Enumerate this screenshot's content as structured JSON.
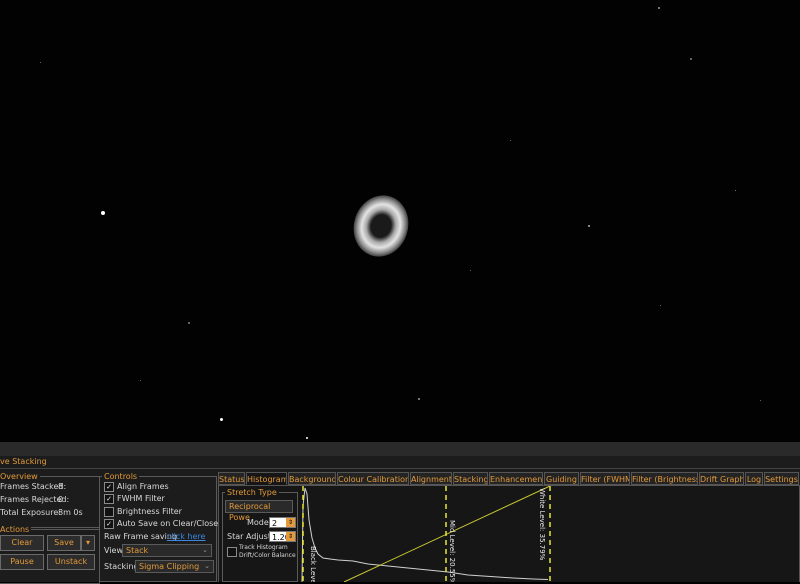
{
  "panel": {
    "title": "ve Stacking"
  },
  "overview": {
    "label": "Overview",
    "frames_stacked_label": "Frames Stacked:",
    "frames_stacked": "8",
    "frames_rejected_label": "Frames Rejected:",
    "frames_rejected": "0",
    "total_exposure_label": "Total Exposure:",
    "total_exposure": "8m 0s"
  },
  "actions": {
    "label": "Actions",
    "clear": "Clear",
    "save": "Save",
    "save_arrow": "▾",
    "pause": "Pause",
    "unstack": "Unstack"
  },
  "controls": {
    "label": "Controls",
    "align_frames": "Align Frames",
    "align_frames_checked": true,
    "fwhm_filter": "FWHM Filter",
    "fwhm_filter_checked": true,
    "brightness_filter": "Brightness Filter",
    "brightness_filter_checked": false,
    "auto_save": "Auto Save on Clear/Close",
    "auto_save_checked": true,
    "raw_frame_label": "Raw Frame saving",
    "raw_frame_link": "click here",
    "view_label": "View",
    "view_value": "Stack",
    "stacking_label": "Stacking",
    "stacking_value": "Sigma Clipping"
  },
  "tabs": [
    "Status",
    "Histogram",
    "Background",
    "Colour Calibration",
    "Alignment",
    "Stacking",
    "Enhancement",
    "Guiding",
    "Filter (FWHM)",
    "Filter (Brightness)",
    "Drift Graph",
    "Log",
    "Settings"
  ],
  "active_tab": "Histogram",
  "stretch": {
    "label": "Stretch Type",
    "type_value": "Reciprocal Powe",
    "mode_label": "Mode",
    "mode_value": "2",
    "star_adjust_label": "Star Adjust",
    "star_adjust_value": "1.20",
    "track_histogram_label_1": "Track Histogram",
    "track_histogram_label_2": "Drift/Color Balance",
    "track_histogram_checked": false
  },
  "histogram": {
    "black_level_label": "Black Level .00%",
    "mid_level_label": "Mid Level: 20.55%",
    "white_level_label": "White Level: 35.79%",
    "black_level": 0.0,
    "mid_level": 20.55,
    "white_level": 35.79
  },
  "colors": {
    "accent": "#e49a3a",
    "link": "#3a86e0",
    "marker": "#e6e632",
    "curve": "#c8c832"
  }
}
